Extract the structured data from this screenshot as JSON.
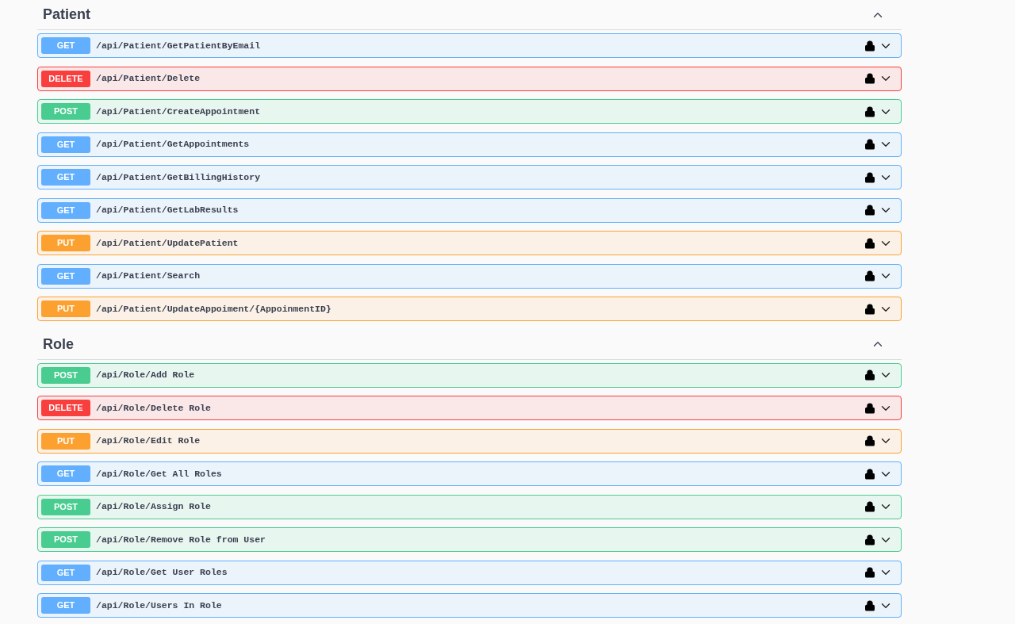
{
  "sections": [
    {
      "title": "Patient",
      "expanded": true,
      "operations": [
        {
          "kind": "get",
          "method": "GET",
          "path": "/api/Patient/GetPatientByEmail",
          "locked": true
        },
        {
          "kind": "delete",
          "method": "DELETE",
          "path": "/api/Patient/Delete",
          "locked": true
        },
        {
          "kind": "post",
          "method": "POST",
          "path": "/api/Patient/CreateAppointment",
          "locked": true
        },
        {
          "kind": "get",
          "method": "GET",
          "path": "/api/Patient/GetAppointments",
          "locked": true
        },
        {
          "kind": "get",
          "method": "GET",
          "path": "/api/Patient/GetBillingHistory",
          "locked": true
        },
        {
          "kind": "get",
          "method": "GET",
          "path": "/api/Patient/GetLabResults",
          "locked": true
        },
        {
          "kind": "put",
          "method": "PUT",
          "path": "/api/Patient/UpdatePatient",
          "locked": true
        },
        {
          "kind": "get",
          "method": "GET",
          "path": "/api/Patient/Search",
          "locked": true
        },
        {
          "kind": "put",
          "method": "PUT",
          "path": "/api/Patient/UpdateAppoiment/{AppoinmentID}",
          "locked": true
        }
      ]
    },
    {
      "title": "Role",
      "expanded": true,
      "operations": [
        {
          "kind": "post",
          "method": "POST",
          "path": "/api/Role/Add Role",
          "locked": true
        },
        {
          "kind": "delete",
          "method": "DELETE",
          "path": "/api/Role/Delete Role",
          "locked": true
        },
        {
          "kind": "put",
          "method": "PUT",
          "path": "/api/Role/Edit Role",
          "locked": true
        },
        {
          "kind": "get",
          "method": "GET",
          "path": "/api/Role/Get All Roles",
          "locked": true
        },
        {
          "kind": "post",
          "method": "POST",
          "path": "/api/Role/Assign Role",
          "locked": true
        },
        {
          "kind": "post",
          "method": "POST",
          "path": "/api/Role/Remove Role from User",
          "locked": true
        },
        {
          "kind": "get",
          "method": "GET",
          "path": "/api/Role/Get User Roles",
          "locked": true
        },
        {
          "kind": "get",
          "method": "GET",
          "path": "/api/Role/Users In Role",
          "locked": true
        }
      ]
    }
  ]
}
